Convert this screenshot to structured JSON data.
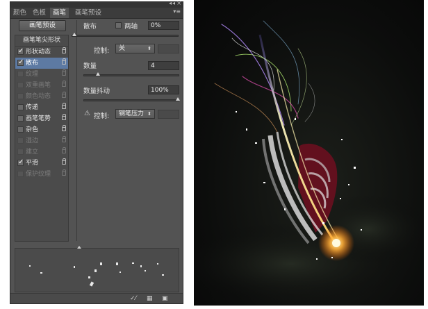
{
  "panel": {
    "tabs": [
      {
        "label": "颜色",
        "active": false
      },
      {
        "label": "色板",
        "active": false
      },
      {
        "label": "画笔",
        "active": true
      },
      {
        "label": "画笔预设",
        "active": false
      }
    ],
    "top_controls": {
      "collapse": "◂◂",
      "close": "×",
      "menu": "▾≡"
    },
    "preset_button": "画笔预设",
    "brush_tip_header": "画笔笔尖形状",
    "options": [
      {
        "label": "形状动态",
        "checked": true,
        "enabled": true,
        "selected": false
      },
      {
        "label": "散布",
        "checked": true,
        "enabled": true,
        "selected": true
      },
      {
        "label": "纹理",
        "checked": false,
        "enabled": false,
        "selected": false
      },
      {
        "label": "双重画笔",
        "checked": false,
        "enabled": false,
        "selected": false
      },
      {
        "label": "颜色动态",
        "checked": false,
        "enabled": false,
        "selected": false
      },
      {
        "label": "传递",
        "checked": false,
        "enabled": true,
        "selected": false
      },
      {
        "label": "画笔笔势",
        "checked": false,
        "enabled": true,
        "selected": false
      },
      {
        "label": "杂色",
        "checked": false,
        "enabled": true,
        "selected": false
      },
      {
        "label": "湿边",
        "checked": false,
        "enabled": false,
        "selected": false
      },
      {
        "label": "建立",
        "checked": false,
        "enabled": false,
        "selected": false
      },
      {
        "label": "平滑",
        "checked": true,
        "enabled": true,
        "selected": false
      },
      {
        "label": "保护纹理",
        "checked": false,
        "enabled": false,
        "selected": false
      }
    ],
    "scatter": {
      "label": "散布",
      "both_axes_label": "两轴",
      "both_axes_checked": false,
      "value": "0%",
      "value_fraction": 0.0,
      "control_label": "控制:",
      "control_value": "关"
    },
    "count": {
      "label": "数量",
      "value": "4",
      "value_fraction": 0.13
    },
    "count_jitter": {
      "label": "数量抖动",
      "value": "100%",
      "value_fraction": 1.0,
      "warning_icon": "⚠",
      "control_label": "控制:",
      "control_value": "钢笔压力"
    },
    "bottom_icons": [
      "✓⁄",
      "▦",
      "▣"
    ]
  }
}
